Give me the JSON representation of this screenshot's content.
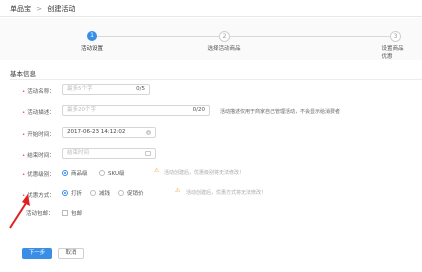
{
  "breadcrumb": {
    "parent": "单品宝",
    "separator": ">",
    "current": "创建活动"
  },
  "steps": [
    {
      "number": "1",
      "label": "活动设置",
      "state": "active"
    },
    {
      "number": "2",
      "label": "选择活动商品",
      "state": "inactive"
    },
    {
      "number": "3",
      "label": "设置商品优惠",
      "state": "inactive"
    }
  ],
  "section_title": "基本信息",
  "form": {
    "name": {
      "label": "活动名称：",
      "placeholder": "最多5个字",
      "counter": "0/5"
    },
    "desc": {
      "label": "活动描述：",
      "placeholder": "最多20个字",
      "counter": "0/20",
      "hint": "活动描述仅用于商家自己管理活动，不会显示给消费者"
    },
    "start": {
      "label": "开始时间：",
      "value": "2017-06-23 14:12:02",
      "clear_icon": "x"
    },
    "end": {
      "label": "结束时间：",
      "placeholder": "结束时间"
    },
    "level": {
      "label": "优惠级别：",
      "options": [
        "商品级",
        "SKU级"
      ],
      "selected": "商品级",
      "warning": "活动创建后，优惠级别将无法修改！"
    },
    "method": {
      "label": "优惠方式：",
      "options": [
        "打折",
        "减钱",
        "促销价"
      ],
      "selected": "打折",
      "warning": "活动创建后，优惠方式将无法修改！"
    },
    "shipping": {
      "label": "活动包邮：",
      "checkbox_label": "包邮"
    }
  },
  "buttons": {
    "next": "下一步",
    "cancel": "取消"
  },
  "colors": {
    "accent": "#3a8ee6",
    "required": "#e94b3c",
    "warning": "#e8a040",
    "annotation_arrow": "#e02020"
  },
  "icons": {
    "warning": "⚠"
  }
}
